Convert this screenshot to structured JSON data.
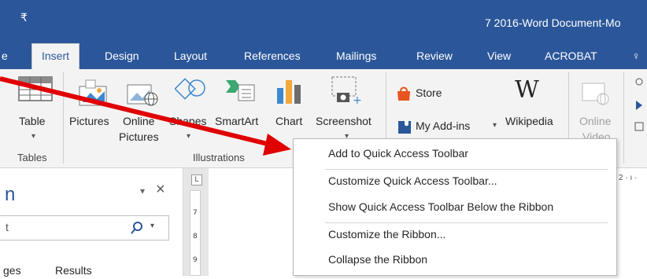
{
  "titlebar": {
    "qat_glyph": "₹",
    "doc_title": "7 2016-Word Document-Mo"
  },
  "tabs": [
    {
      "label": "e",
      "left": 0
    },
    {
      "label": "Insert",
      "active": true
    },
    {
      "label": "Design"
    },
    {
      "label": "Layout"
    },
    {
      "label": "References"
    },
    {
      "label": "Mailings"
    },
    {
      "label": "Review"
    },
    {
      "label": "View"
    },
    {
      "label": "ACROBAT"
    },
    {
      "label": "♀"
    }
  ],
  "ribbon": {
    "table": {
      "label": "Table",
      "group": "Tables"
    },
    "pictures": {
      "label": "Pictures"
    },
    "online_pictures": {
      "line1": "Online",
      "line2": "Pictures"
    },
    "shapes": {
      "label": "Shapes"
    },
    "smartart": {
      "label": "SmartArt"
    },
    "chart": {
      "label": "Chart"
    },
    "screenshot": {
      "label": "Screenshot"
    },
    "illustrations_group": "Illustrations",
    "store": {
      "label": "Store"
    },
    "my_addins": {
      "label": "My Add-ins"
    },
    "wikipedia": {
      "label": "Wikipedia",
      "glyph": "W"
    },
    "online_video": {
      "line1": "Online",
      "line2": "Video"
    }
  },
  "nav_pane": {
    "title_fragment": "n",
    "search_placeholder": "t",
    "tab_left": "ges",
    "tab_right": "Results",
    "close_glyph": "×",
    "dropdown_glyph": "▾"
  },
  "context_menu": {
    "items": [
      {
        "label": "Add to Quick Access Toolbar",
        "highlighted": true
      },
      {
        "label": "Customize Quick Access Toolbar..."
      },
      {
        "label": "Show Quick Access Toolbar Below the Ribbon"
      },
      {
        "label": "Customize the Ribbon..."
      },
      {
        "label": "Collapse the Ribbon"
      }
    ]
  },
  "ruler_text": "2 · ı ·",
  "colors": {
    "accent": "#2b579a",
    "arrow": "#e00000"
  }
}
